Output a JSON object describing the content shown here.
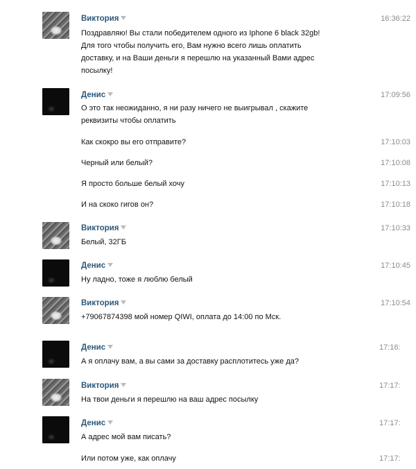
{
  "messages": [
    {
      "author": "Виктория",
      "avatar": "viktoria",
      "time": "16:36:22",
      "lines": [
        "Поздравляю! Вы стали победителем одного из Iphone 6 black 32gb!",
        "Для того чтобы получить его, Вам нужно всего лишь оплатить",
        "доставку, и на Ваши деньги я перешлю на указанный Вами адрес",
        "посылку!"
      ]
    },
    {
      "author": "Денис",
      "avatar": "denis",
      "time": "17:09:56",
      "lines": [
        "О это так неожиданно, я ни разу ничего не выигрывал , скажите",
        "реквизиты чтобы оплатить"
      ]
    },
    {
      "time": "17:10:03",
      "lines": [
        "Как скокро вы его отправите?"
      ]
    },
    {
      "time": "17:10:08",
      "lines": [
        "Черный или белый?"
      ]
    },
    {
      "time": "17:10:13",
      "lines": [
        "Я просто больше белый хочу"
      ]
    },
    {
      "time": "17:10:18",
      "lines": [
        "И на скоко гигов он?"
      ]
    },
    {
      "author": "Виктория",
      "avatar": "viktoria",
      "time": "17:10:33",
      "lines": [
        "Белый, 32ГБ"
      ]
    },
    {
      "author": "Денис",
      "avatar": "denis",
      "time": "17:10:45",
      "lines": [
        "Ну ладно, тоже я люблю белый"
      ]
    },
    {
      "author": "Виктория",
      "avatar": "viktoria",
      "time": "17:10:54",
      "lines": [
        "+79067874398 мой номер QIWI, оплата до 14:00 по Мск."
      ]
    },
    {
      "author": "Денис",
      "avatar": "denis",
      "time": "17:16:",
      "lines": [
        "А я оплачу вам, а вы сами за доставку расплотитесь уже да?"
      ]
    },
    {
      "author": "Виктория",
      "avatar": "viktoria",
      "time": "17:17:",
      "lines": [
        "На твои деньги я перешлю на ваш адрес посылку"
      ]
    },
    {
      "author": "Денис",
      "avatar": "denis",
      "time": "17:17:",
      "lines": [
        "А адрес мой вам писать?"
      ]
    },
    {
      "time": "17:17:",
      "lines": [
        "Или потом уже, как оплачу"
      ]
    }
  ],
  "colors": {
    "author_name": "#2b587a",
    "timestamp": "#8b8b8b",
    "dropdown_arrow": "#bcbcbc"
  },
  "icons": {
    "author_menu": "chevron-down-icon"
  }
}
